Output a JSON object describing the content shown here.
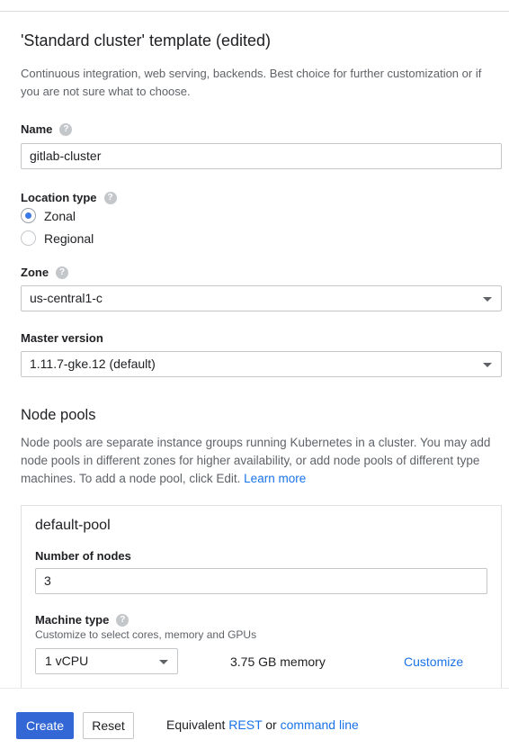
{
  "header": {
    "title": "'Standard cluster' template (edited)",
    "description": "Continuous integration, web serving, backends. Best choice for further customization or if you are not sure what to choose."
  },
  "name_field": {
    "label": "Name",
    "value": "gitlab-cluster",
    "help_icon": "help-icon"
  },
  "location_type": {
    "label": "Location type",
    "help_icon": "help-icon",
    "options": [
      {
        "label": "Zonal",
        "selected": true
      },
      {
        "label": "Regional",
        "selected": false
      }
    ]
  },
  "zone": {
    "label": "Zone",
    "value": "us-central1-c",
    "help_icon": "help-icon"
  },
  "master_version": {
    "label": "Master version",
    "value": "1.11.7-gke.12 (default)"
  },
  "node_pools": {
    "title": "Node pools",
    "description": "Node pools are separate instance groups running Kubernetes in a cluster. You may add node pools in different zones for higher availability, or add node pools of different type machines. To add a node pool, click Edit.",
    "learn_more": "Learn more",
    "pool": {
      "name": "default-pool",
      "nodes_label": "Number of nodes",
      "nodes_value": "3",
      "machine_type_label": "Machine type",
      "machine_type_sub": "Customize to select cores, memory and GPUs",
      "cpu_value": "1 vCPU",
      "memory": "3.75 GB memory",
      "customize": "Customize"
    }
  },
  "footer": {
    "create": "Create",
    "reset": "Reset",
    "equiv_prefix": "Equivalent",
    "rest": "REST",
    "or": "or",
    "command_line": "command line"
  },
  "colors": {
    "primary": "#3367d6",
    "link": "#1a73e8",
    "radio": "#3b78e7"
  }
}
